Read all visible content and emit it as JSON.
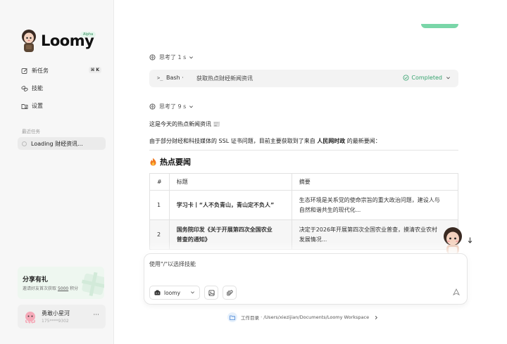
{
  "sidebar": {
    "logo_text": "Loomy",
    "alpha_badge": "Alpha",
    "nav": [
      {
        "label": "新任务",
        "icon": "edit-icon",
        "shortcut": "⌘ K"
      },
      {
        "label": "技能",
        "icon": "link-icon"
      },
      {
        "label": "设置",
        "icon": "folder-settings-icon"
      }
    ],
    "recent_label": "最近任务",
    "recent_tasks": [
      {
        "label": "Loading 财经资讯..."
      }
    ],
    "share": {
      "title": "分享有礼",
      "subtitle_pre": "邀请好友首次获取",
      "points": "5000",
      "subtitle_post": "积分"
    },
    "user": {
      "name": "勇敢小星河",
      "phone": "175****9302",
      "more": "···"
    }
  },
  "conversation": {
    "thinking1": "思考了 1 s",
    "tool": {
      "prompt": ">_",
      "name": "Bash",
      "separator": "·",
      "description": "获取热点财经新闻资讯",
      "status": "Completed"
    },
    "thinking2": "思考了 9 s",
    "line1": "这是今天的热点新闻资讯 📰",
    "line2_pre": "由于部分财经和科技媒体的 SSL 证书问题，目前主要获取到了来自 ",
    "line2_bold": "人民网时政",
    "line2_post": " 的最新要闻：",
    "section_heading": "热点要闻",
    "table": {
      "headers": [
        "#",
        "标题",
        "摘要"
      ],
      "rows": [
        {
          "num": "1",
          "title": "学习卡丨“人不负青山，青山定不负人”",
          "summary_l1": "生态环境是关系党的使命宗旨的重大政治问题，建设人与",
          "summary_l2": "自然和谐共生的现代化..."
        },
        {
          "num": "2",
          "title_l1": "国务院印发《关于开展第四次全国农业",
          "title_l2": "普查的通知》",
          "summary_l1": "决定于2026年开展第四次全国农业普查，摸清农业农村",
          "summary_l2": "发展情况..."
        }
      ]
    }
  },
  "input": {
    "placeholder": "使用\"/\"以选择技能",
    "model": "loomy"
  },
  "workspace": {
    "label": "工作目录",
    "separator": "·",
    "path": "/Users/xiezijian/Documents/Loomy Workspace"
  },
  "colors": {
    "accent_green": "#36a36f",
    "pill": "#79d6a8"
  }
}
